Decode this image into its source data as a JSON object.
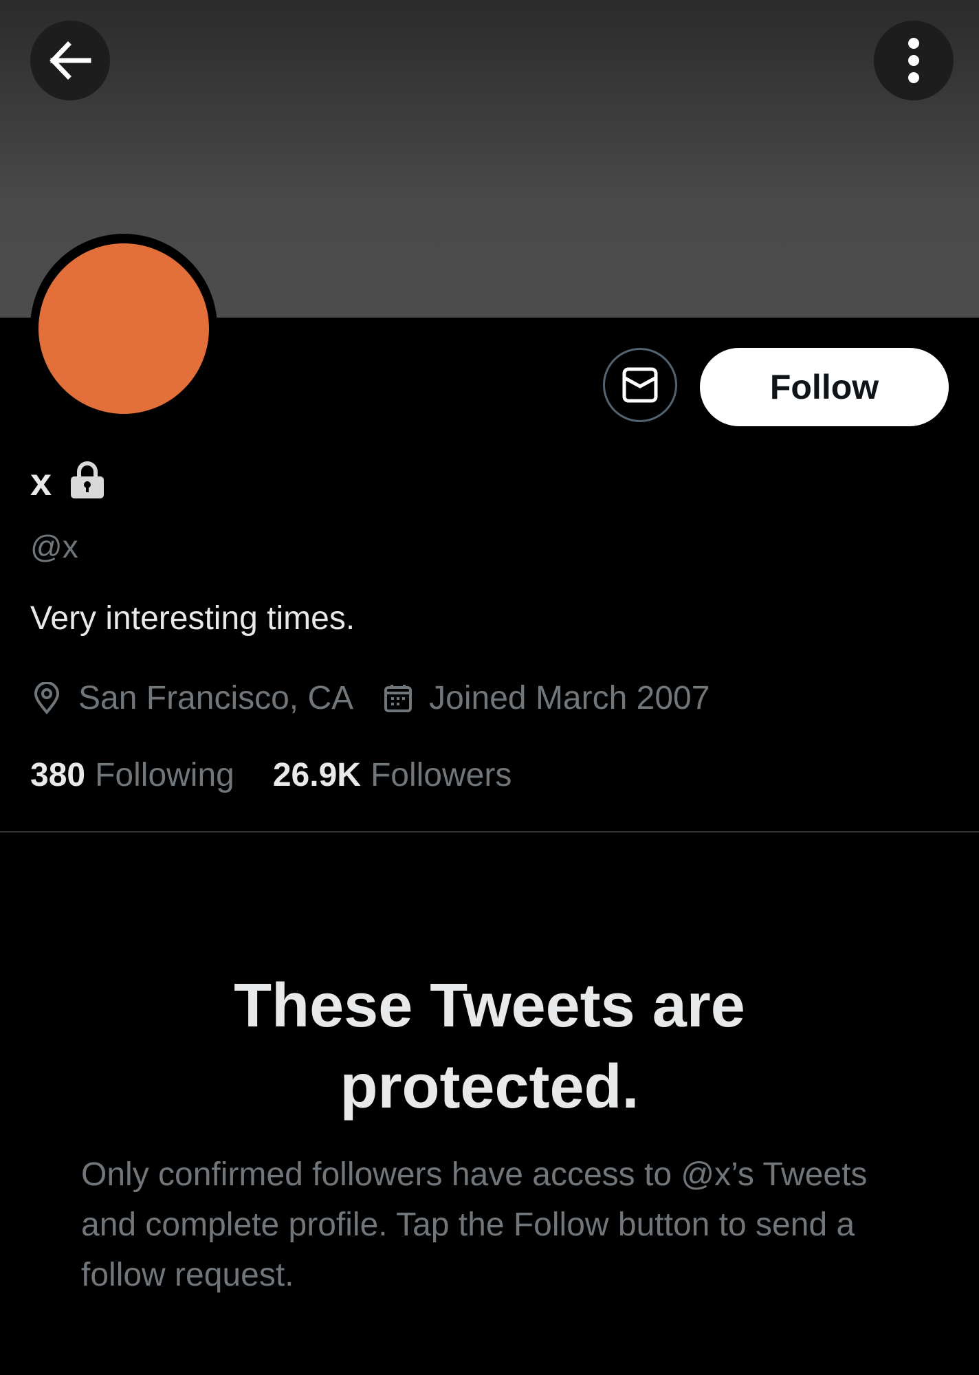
{
  "colors": {
    "avatar": "#e3703a",
    "background": "#000000",
    "primary_text": "#e7e9ea",
    "secondary_text": "#71767b",
    "follow_button_bg": "#ffffff",
    "follow_button_text": "#0f1419"
  },
  "header": {
    "back_icon": "arrow-left-icon",
    "more_icon": "more-vertical-icon"
  },
  "profile": {
    "display_name": "x",
    "protected_icon": "lock-icon",
    "handle": "@x",
    "bio": "Very interesting times.",
    "location": "San Francisco, CA",
    "location_icon": "location-pin-icon",
    "joined": "Joined March 2007",
    "joined_icon": "calendar-icon",
    "following_count": "380",
    "following_label": "Following",
    "followers_count": "26.9K",
    "followers_label": "Followers"
  },
  "actions": {
    "message_icon": "envelope-icon",
    "follow_label": "Follow"
  },
  "protected_notice": {
    "title": "These Tweets are protected.",
    "body": "Only confirmed followers have access to @x’s Tweets and complete profile. Tap the Follow button to send a follow request."
  }
}
